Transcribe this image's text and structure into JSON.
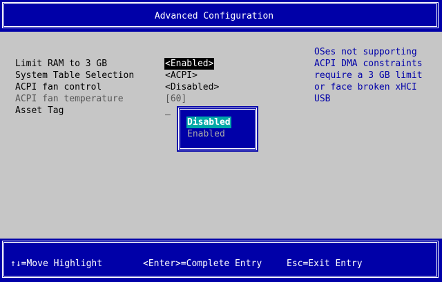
{
  "title": "Advanced Configuration",
  "settings": [
    {
      "label": "Limit RAM to 3 GB",
      "value": "<Enabled>"
    },
    {
      "label": "System Table Selection",
      "value": "<ACPI>"
    },
    {
      "label": "ACPI fan control",
      "value": "<Disabled>"
    },
    {
      "label": "ACPI fan temperature",
      "value": "[60]"
    },
    {
      "label": "Asset Tag",
      "value": "_"
    }
  ],
  "help": [
    "OSes not supporting",
    "ACPI DMA constraints",
    "require a 3 GB limit",
    "or face broken xHCI",
    "USB"
  ],
  "popup": {
    "options": [
      "Disabled",
      "Enabled"
    ],
    "selected": "Disabled"
  },
  "footer": {
    "move": "↑↓=Move Highlight",
    "enter": "<Enter>=Complete Entry",
    "esc": "Esc=Exit Entry"
  },
  "colors": {
    "background": "#c6c6c6",
    "frame_blue": "#0000a8",
    "highlight_cyan": "#00a8a8",
    "text_white": "#ffffff"
  }
}
